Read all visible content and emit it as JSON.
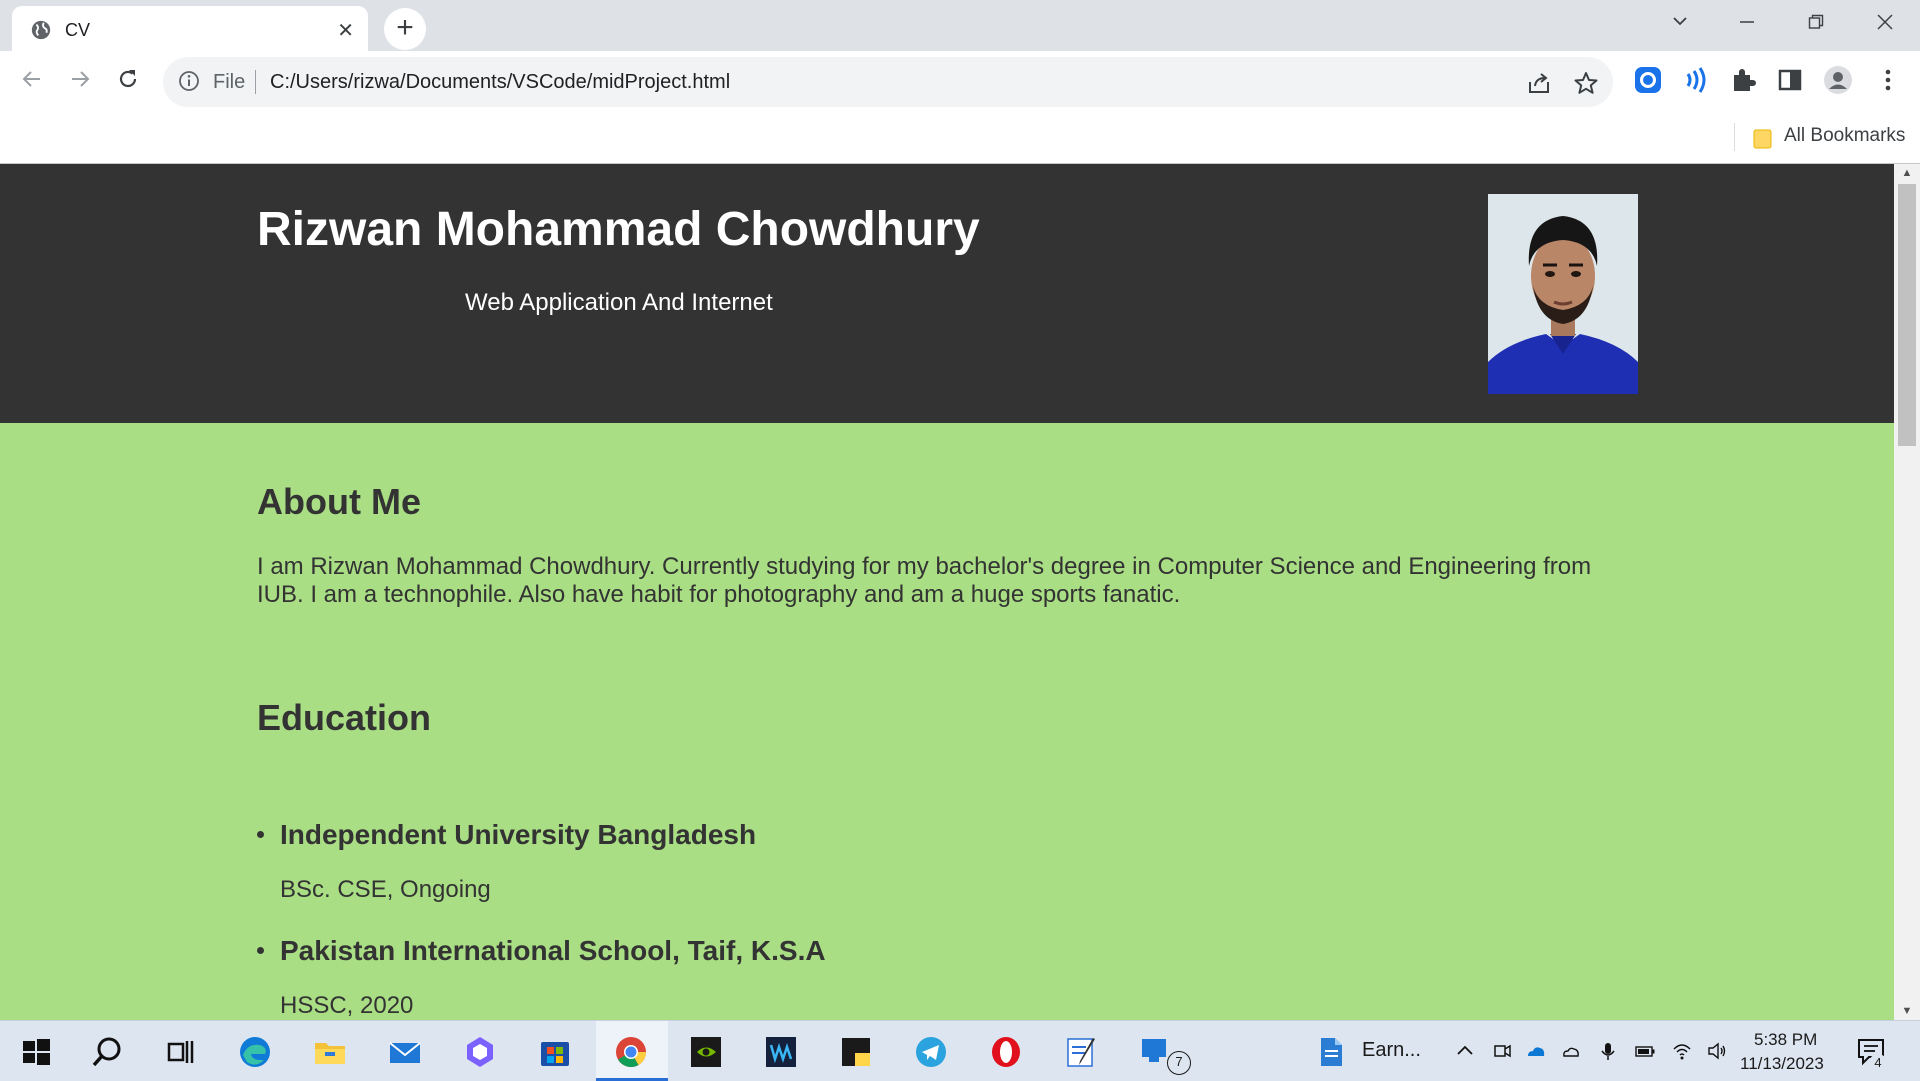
{
  "browser": {
    "tab_title": "CV",
    "tab_close": "✕",
    "new_tab": "+",
    "scheme_label": "File",
    "url": "C:/Users/rizwa/Documents/VSCode/midProject.html",
    "bookmarks_label": "All Bookmarks"
  },
  "page": {
    "name": "Rizwan Mohammad Chowdhury",
    "subtitle": "Web Application And Internet",
    "about_heading": "About Me",
    "about_text": "I am Rizwan Mohammad Chowdhury. Currently studying for my bachelor's degree in Computer Science and Engineering from IUB. I am a technophile. Also have habit for photography and am a huge sports fanatic.",
    "education_heading": "Education",
    "education": [
      {
        "school": "Independent University Bangladesh",
        "degree": "BSc. CSE, Ongoing"
      },
      {
        "school": "Pakistan International School, Taif, K.S.A",
        "degree": "HSSC, 2020"
      }
    ]
  },
  "taskbar": {
    "app_label": "Earn...",
    "time": "5:38 PM",
    "date": "11/13/2023",
    "explorer_badge": "7",
    "notification_badge": "4"
  },
  "colors": {
    "header_bg": "#333333",
    "content_bg": "#a9de84",
    "text": "#333333",
    "accent": "#1a73e8"
  }
}
